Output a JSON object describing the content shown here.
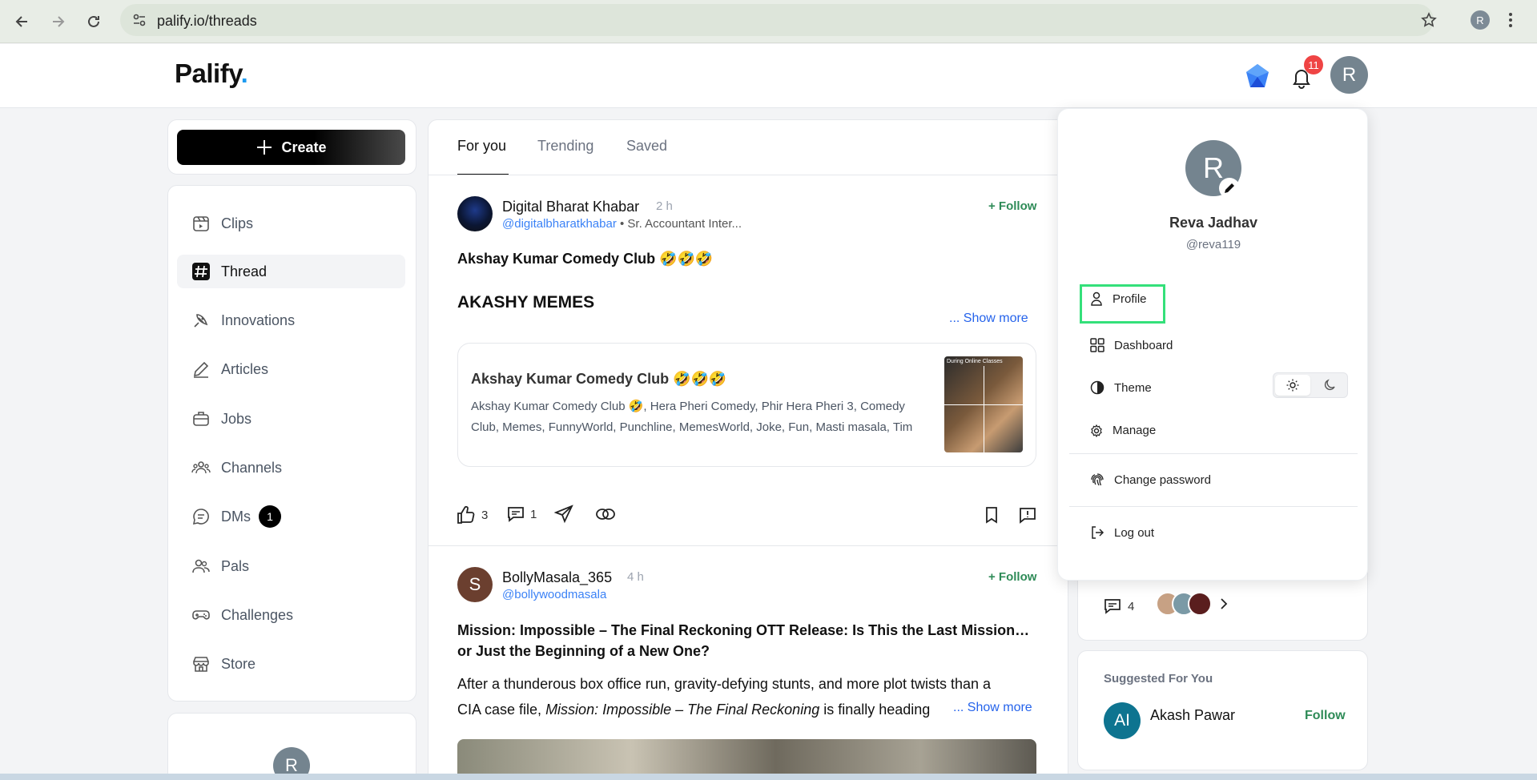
{
  "browser": {
    "url": "palify.io/threads",
    "profile_initial": "R"
  },
  "header": {
    "logo_text": "Palify",
    "logo_dot": ".",
    "notification_count": "11",
    "avatar_initial": "R"
  },
  "sidebar": {
    "create_label": "Create",
    "items": [
      {
        "label": "Clips",
        "icon": "clips-icon"
      },
      {
        "label": "Thread",
        "icon": "hash-icon"
      },
      {
        "label": "Innovations",
        "icon": "innovations-icon"
      },
      {
        "label": "Articles",
        "icon": "pencil-icon"
      },
      {
        "label": "Jobs",
        "icon": "briefcase-icon"
      },
      {
        "label": "Channels",
        "icon": "channels-icon"
      },
      {
        "label": "DMs",
        "icon": "chat-icon",
        "badge": "1"
      },
      {
        "label": "Pals",
        "icon": "users-icon"
      },
      {
        "label": "Challenges",
        "icon": "gamepad-icon"
      },
      {
        "label": "Store",
        "icon": "store-icon"
      }
    ],
    "bottom_avatar_initial": "R"
  },
  "feed": {
    "tabs": [
      {
        "label": "For you",
        "active": true
      },
      {
        "label": "Trending",
        "active": false
      },
      {
        "label": "Saved",
        "active": false
      }
    ],
    "posts": [
      {
        "author": "Digital Bharat Khabar",
        "time": "2 h",
        "handle": "@digitalbharatkhabar",
        "subtitle": " • Sr. Accountant Inter...",
        "follow_label": "+ Follow",
        "title": "Akshay Kumar Comedy Club 🤣🤣🤣",
        "heading": "AKASHY MEMES",
        "show_more": "... Show more",
        "link_card": {
          "title": "Akshay Kumar Comedy Club 🤣🤣🤣",
          "description": "Akshay Kumar Comedy Club 🤣, Hera Pheri Comedy, Phir Hera Pheri 3, Comedy Club, Memes, FunnyWorld, Punchline, MemesWorld, Joke, Fun, Masti masala, Tim",
          "thumb_caption": "During Online Classes"
        },
        "likes": "3",
        "comments": "1"
      },
      {
        "author": "BollyMasala_365",
        "time": "4 h",
        "handle": "@bollywoodmasala",
        "avatar_initial": "S",
        "follow_label": "+ Follow",
        "title": "Mission: Impossible – The Final Reckoning OTT Release: Is This the Last Mission… or Just the Beginning of a New One?",
        "body_start": "After a thunderous box office run, gravity-defying stunts, and more plot twists than a CIA case file, ",
        "body_italic": "Mission: Impossible – The Final Reckoning",
        "body_end": " is finally heading",
        "show_more": "... Show more"
      }
    ]
  },
  "right": {
    "comment_count": "4",
    "suggested_title": "Suggested For You",
    "suggested": [
      {
        "initials": "AI",
        "name": "Akash Pawar",
        "follow_label": "Follow"
      }
    ]
  },
  "dropdown": {
    "avatar_initial": "R",
    "name": "Reva Jadhav",
    "handle": "@reva119",
    "items": {
      "profile": "Profile",
      "dashboard": "Dashboard",
      "theme": "Theme",
      "manage": "Manage",
      "change_password": "Change password",
      "logout": "Log out"
    }
  },
  "colors": {
    "accent_green": "#2e8b57",
    "link_blue": "#3b82f6",
    "badge_red": "#ef4444",
    "highlight": "#34e07a"
  }
}
